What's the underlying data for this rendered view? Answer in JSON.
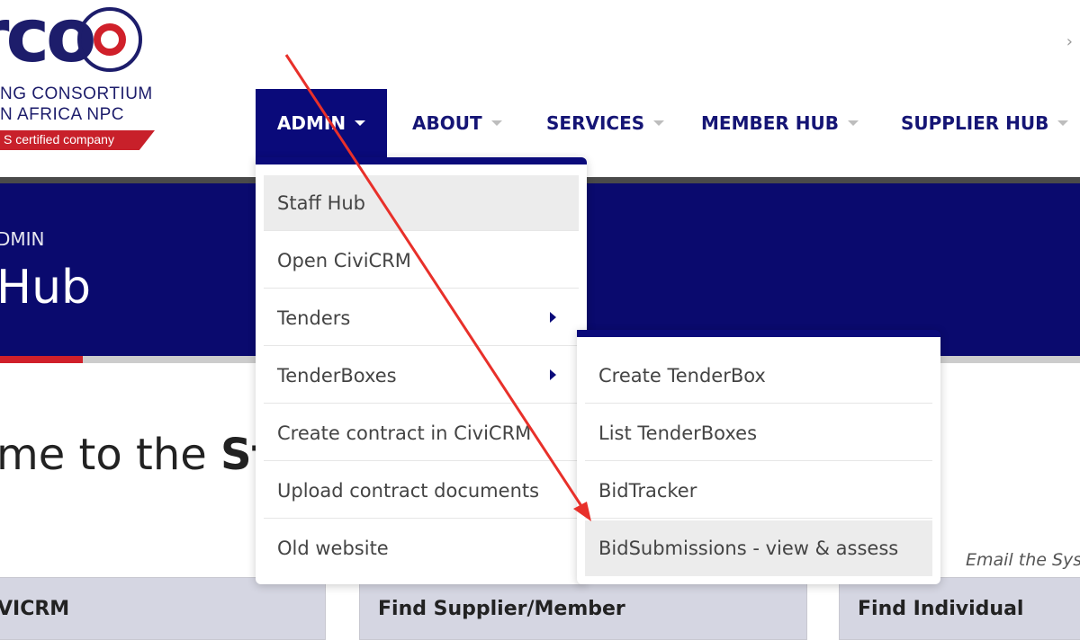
{
  "logo": {
    "word": "rco",
    "line1": "NG CONSORTIUM",
    "line2": "N AFRICA NPC",
    "banner": "S certified company"
  },
  "nav": {
    "items": [
      {
        "label": "ADMIN"
      },
      {
        "label": "ABOUT"
      },
      {
        "label": "SERVICES"
      },
      {
        "label": "MEMBER HUB"
      },
      {
        "label": "SUPPLIER HUB"
      }
    ],
    "overflow_icon": "chevron-right-icon"
  },
  "hero": {
    "breadcrumb": "DMIN",
    "title": "Hub"
  },
  "welcome": {
    "prefix": "me to the ",
    "bold": "Sta"
  },
  "email_note": "Email the Sys",
  "cards": [
    {
      "label": "VICRM"
    },
    {
      "label": "Find Supplier/Member"
    },
    {
      "label": "Find Individual"
    }
  ],
  "dropdown": {
    "items": [
      {
        "label": "Staff Hub"
      },
      {
        "label": "Open CiviCRM"
      },
      {
        "label": "Tenders"
      },
      {
        "label": "TenderBoxes"
      },
      {
        "label": "Create contract in CiviCRM"
      },
      {
        "label": "Upload contract documents"
      },
      {
        "label": "Old website"
      }
    ]
  },
  "submenu": {
    "items": [
      {
        "label": "Create TenderBox"
      },
      {
        "label": "List TenderBoxes"
      },
      {
        "label": "BidTracker"
      },
      {
        "label": "BidSubmissions - view & assess"
      }
    ]
  },
  "colors": {
    "brand_navy": "#0a0a7a",
    "brand_red": "#d0202a",
    "annotation_arrow": "#e8302a"
  }
}
